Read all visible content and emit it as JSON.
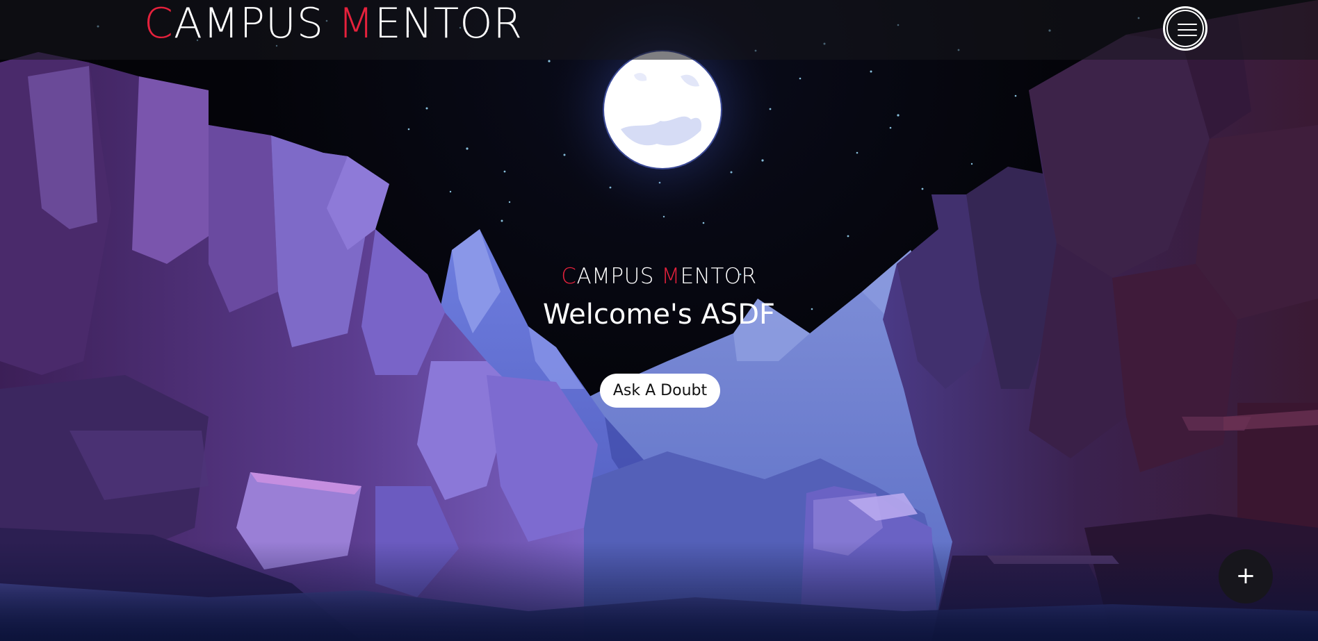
{
  "header": {
    "logo_first_initial": "C",
    "logo_first_rest": "AMPUS ",
    "logo_second_initial": "M",
    "logo_second_rest": "ENTOR",
    "menu_icon": "hamburger-menu-icon"
  },
  "hero": {
    "brand_first_initial": "C",
    "brand_first_rest": "AMPUS ",
    "brand_second_initial": "M",
    "brand_second_rest": "ENTOR",
    "welcome_text": "Welcome's ASDF",
    "cta_label": "Ask A Doubt"
  },
  "fab": {
    "label": "+",
    "icon": "plus-icon"
  },
  "colors": {
    "accent": "#e5213c",
    "text": "#ffffff",
    "sky": "#030309",
    "topbar": "#16161c"
  }
}
